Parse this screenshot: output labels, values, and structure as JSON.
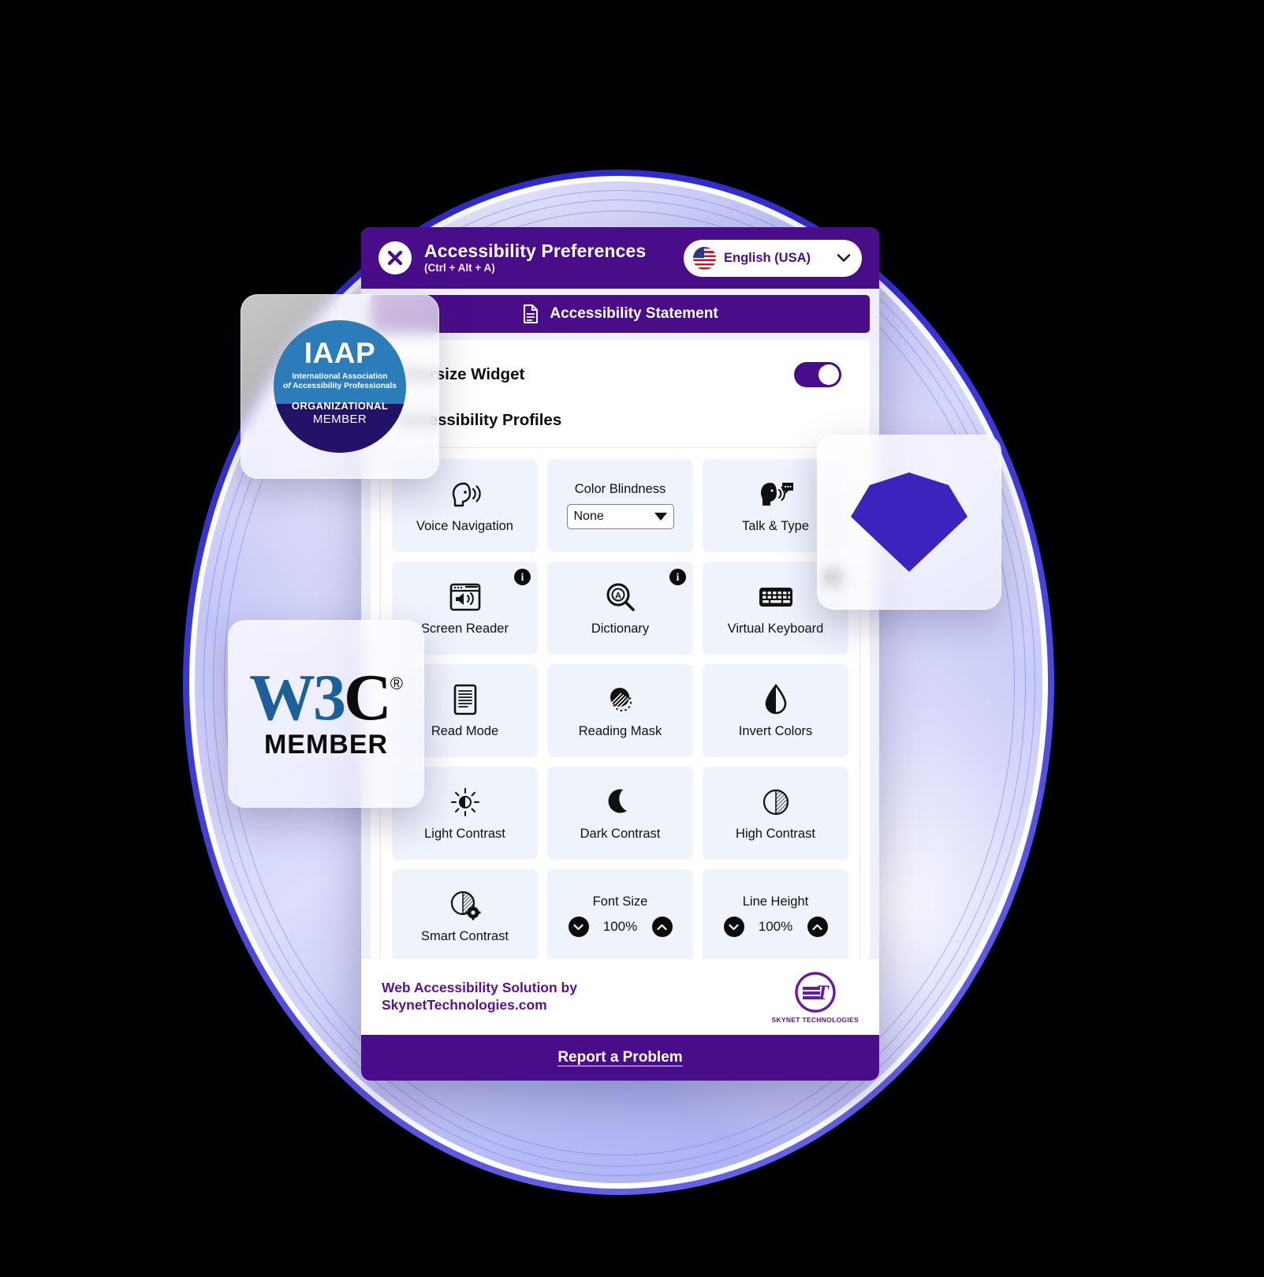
{
  "header": {
    "title": "Accessibility Preferences",
    "shortcut": "(Ctrl + Alt + A)",
    "close_icon": "close-x-icon",
    "language": "English (USA)",
    "chevron_icon": "chevron-down-icon",
    "flag_icon": "usa-flag-icon"
  },
  "statement": {
    "label": "Accessibility Statement",
    "icon": "document-icon"
  },
  "settings": {
    "oversize_widget_label": "Oversize Widget",
    "oversize_widget_state": "on",
    "profiles_label": "Accessibility Profiles"
  },
  "tiles": [
    {
      "label": "Voice Navigation",
      "icon": "speaking-head-icon",
      "type": "toggle",
      "info": false
    },
    {
      "label": "Color Blindness",
      "icon": "none",
      "type": "select",
      "value": "None",
      "info": false
    },
    {
      "label": "Talk & Type",
      "icon": "talk-type-icon",
      "type": "toggle",
      "info": false
    },
    {
      "label": "Screen Reader",
      "icon": "screen-reader-icon",
      "type": "toggle",
      "info": true
    },
    {
      "label": "Dictionary",
      "icon": "dictionary-search-icon",
      "type": "toggle",
      "info": true
    },
    {
      "label": "Virtual Keyboard",
      "icon": "keyboard-icon",
      "type": "toggle",
      "info": true
    },
    {
      "label": "Read Mode",
      "icon": "document-lines-icon",
      "type": "toggle",
      "info": false
    },
    {
      "label": "Reading Mask",
      "icon": "reading-mask-icon",
      "type": "toggle",
      "info": false
    },
    {
      "label": "Invert Colors",
      "icon": "droplet-half-icon",
      "type": "toggle",
      "info": false
    },
    {
      "label": "Light Contrast",
      "icon": "sun-icon",
      "type": "toggle",
      "info": false
    },
    {
      "label": "Dark Contrast",
      "icon": "moon-icon",
      "type": "toggle",
      "info": false
    },
    {
      "label": "High Contrast",
      "icon": "contrast-circle-icon",
      "type": "toggle",
      "info": false
    },
    {
      "label": "Smart Contrast",
      "icon": "contrast-gear-icon",
      "type": "toggle",
      "info": false
    },
    {
      "label": "Font Size",
      "icon": "none",
      "type": "stepper",
      "value": "100%",
      "info": false
    },
    {
      "label": "Line Height",
      "icon": "none",
      "type": "stepper",
      "value": "100%",
      "info": false
    }
  ],
  "footer": {
    "line1": "Web Accessibility Solution by",
    "line2": "SkynetTechnologies.com",
    "logo_initials": "ST",
    "logo_name": "SKYNET TECHNOLOGIES",
    "report_label": "Report a Problem"
  },
  "badges": {
    "iaap": {
      "acronym": "IAAP",
      "line1": "International Association",
      "line2_italic": "of",
      "line2": "Accessibility Professionals",
      "org": "ORGANIZATIONAL",
      "member": "MEMBER"
    },
    "w3c": {
      "mark_blue": "W3",
      "mark_black": "C",
      "registered": "®",
      "member": "MEMBER"
    },
    "gem": {
      "icon": "diamond-gem-icon"
    }
  },
  "colors": {
    "brand_purple": "#4a0d8a",
    "accent_violet": "#3d23bd",
    "tile_bg": "#eef3fc",
    "iaap_blue": "#2b7cb9",
    "iaap_navy": "#241268",
    "w3c_blue": "#1d5f99"
  }
}
